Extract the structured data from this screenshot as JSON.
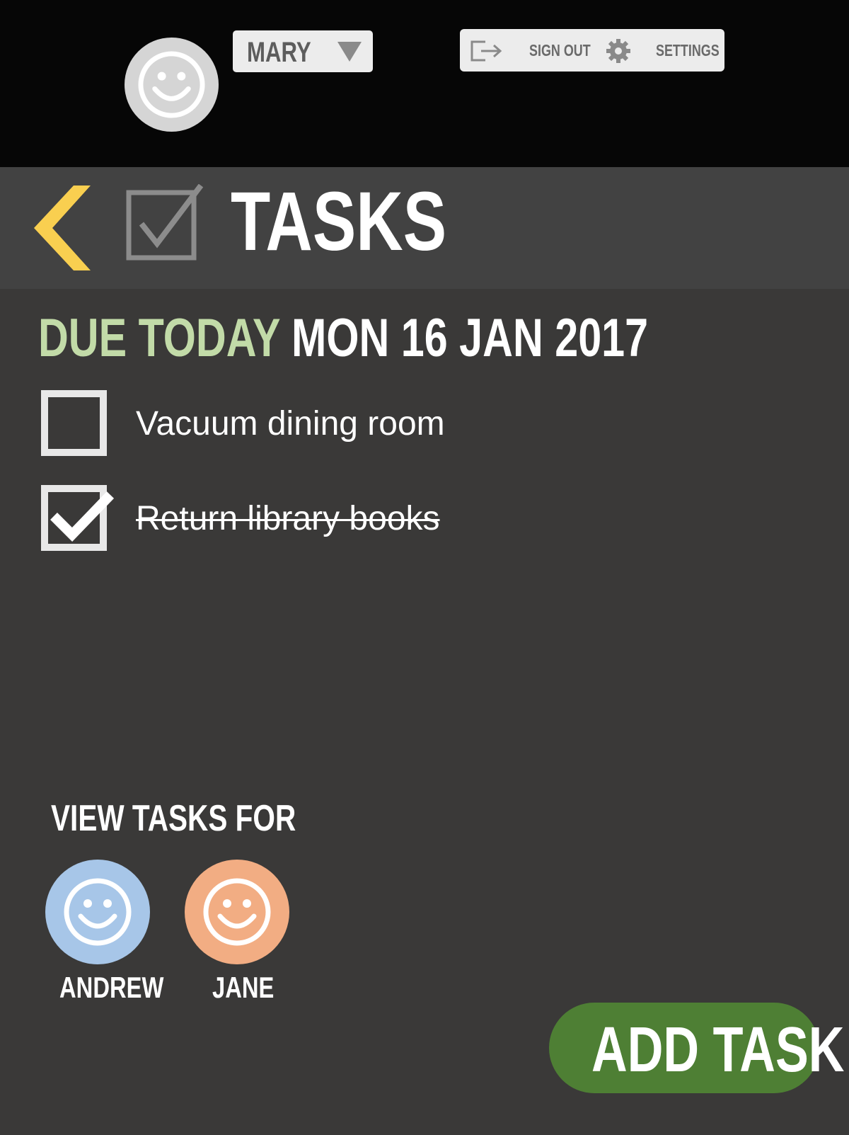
{
  "topbar": {
    "user": {
      "name": "MARY",
      "avatar_icon": "smiley-face-icon",
      "dropdown_icon": "triangle-down-icon"
    },
    "sign_out": {
      "label": "SIGN OUT",
      "icon": "sign-out-icon"
    },
    "settings": {
      "label": "SETTINGS",
      "icon": "gear-icon"
    }
  },
  "header": {
    "back_icon": "chevron-left-icon",
    "section_icon": "checkbox-checked-icon",
    "title": "TASKS"
  },
  "due": {
    "label": "DUE TODAY",
    "date": "MON 16 JAN 2017"
  },
  "tasks": [
    {
      "label": "Vacuum dining room",
      "done": false
    },
    {
      "label": "Return library books",
      "done": true
    }
  ],
  "view_tasks_for": {
    "title": "VIEW TASKS FOR",
    "people": [
      {
        "name": "ANDREW",
        "color": "#a7c6e8"
      },
      {
        "name": "JANE",
        "color": "#f2ad83"
      }
    ]
  },
  "add_task": {
    "label": "ADD TASK"
  },
  "colors": {
    "background": "#3a3938",
    "topbar": "#060606",
    "header": "#424242",
    "accent_back": "#f9cf50",
    "due_label": "#c2dba8",
    "add_task_button": "#4e7f34"
  }
}
